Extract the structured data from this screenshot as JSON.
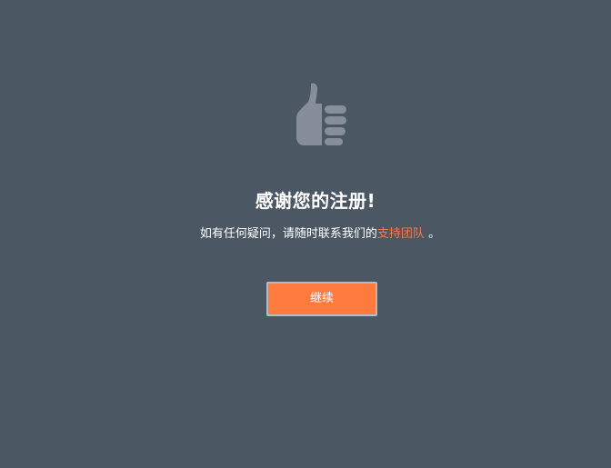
{
  "confirmation": {
    "icon": "thumbs-up-icon",
    "title": "感谢您的注册!",
    "message_prefix": "如有任何疑问，请随时联系我们的",
    "support_link": "支持团队",
    "message_suffix": " 。",
    "continue_label": "继续"
  },
  "colors": {
    "background": "#4b5864",
    "icon": "#858e99",
    "link": "#f47a4c",
    "button": "#ff7a3d",
    "button_border": "#b7bcc2"
  }
}
